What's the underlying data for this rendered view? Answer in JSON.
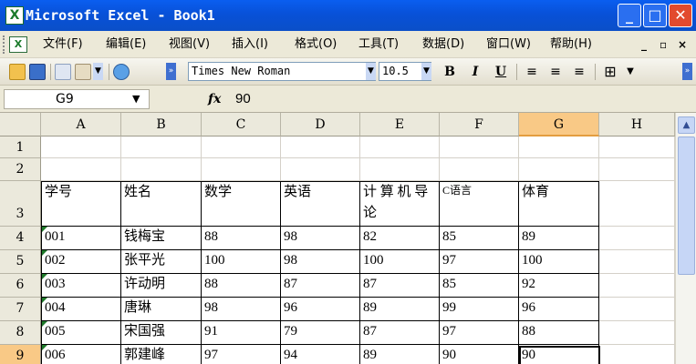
{
  "window": {
    "title": "Microsoft Excel - Book1",
    "app_icon": "excel-icon"
  },
  "window_controls": {
    "minimize": "_",
    "maximize": "□",
    "close": "✕"
  },
  "menubar": {
    "items": [
      "文件(F)",
      "编辑(E)",
      "视图(V)",
      "插入(I)",
      "格式(O)",
      "工具(T)",
      "数据(D)",
      "窗口(W)",
      "帮助(H)"
    ],
    "doc_controls": {
      "minimize": "_",
      "restore": "▫",
      "close": "×"
    }
  },
  "toolbar": {
    "icons": [
      "open-folder-icon",
      "save-icon",
      "copy-icon",
      "paste-icon",
      "help-icon",
      "toolbar-overflow-icon"
    ],
    "font_name": "Times New Roman",
    "font_size": "10.5",
    "bold": "B",
    "italic": "I",
    "underline": "U",
    "align": [
      "align-left-icon",
      "align-center-icon",
      "align-right-icon"
    ],
    "borders": "borders-icon",
    "colors": {
      "open": "#f2c14e",
      "save": "#3a6fc9",
      "help": "#5aa0e6"
    }
  },
  "formula_bar": {
    "name_box": "G9",
    "fx": "fx",
    "value": "90"
  },
  "sheet": {
    "columns": [
      "A",
      "B",
      "C",
      "D",
      "E",
      "F",
      "G",
      "H"
    ],
    "selected_column": "G",
    "rows": [
      "1",
      "2",
      "3",
      "4",
      "5",
      "6",
      "7",
      "8",
      "9"
    ],
    "selected_row": "9",
    "header_row": [
      "学号",
      "姓名",
      "数学",
      "英语",
      "计 算 机 导 论",
      "C语言",
      "体育"
    ],
    "records": [
      [
        "001",
        "钱梅宝",
        "88",
        "98",
        "82",
        "85",
        "89"
      ],
      [
        "002",
        "张平光",
        "100",
        "98",
        "100",
        "97",
        "100"
      ],
      [
        "003",
        "许动明",
        "88",
        "87",
        "87",
        "85",
        "92"
      ],
      [
        "004",
        "唐琳",
        "98",
        "96",
        "89",
        "99",
        "96"
      ],
      [
        "005",
        "宋国强",
        "91",
        "79",
        "87",
        "97",
        "88"
      ],
      [
        "006",
        "郭建峰",
        "97",
        "94",
        "89",
        "90",
        "90"
      ]
    ]
  },
  "colors": {
    "selection_header": "#f9c986",
    "title_bar": "#0a5ef0",
    "close_button": "#e24a2e",
    "error_triangle": "#1f7a2a"
  }
}
